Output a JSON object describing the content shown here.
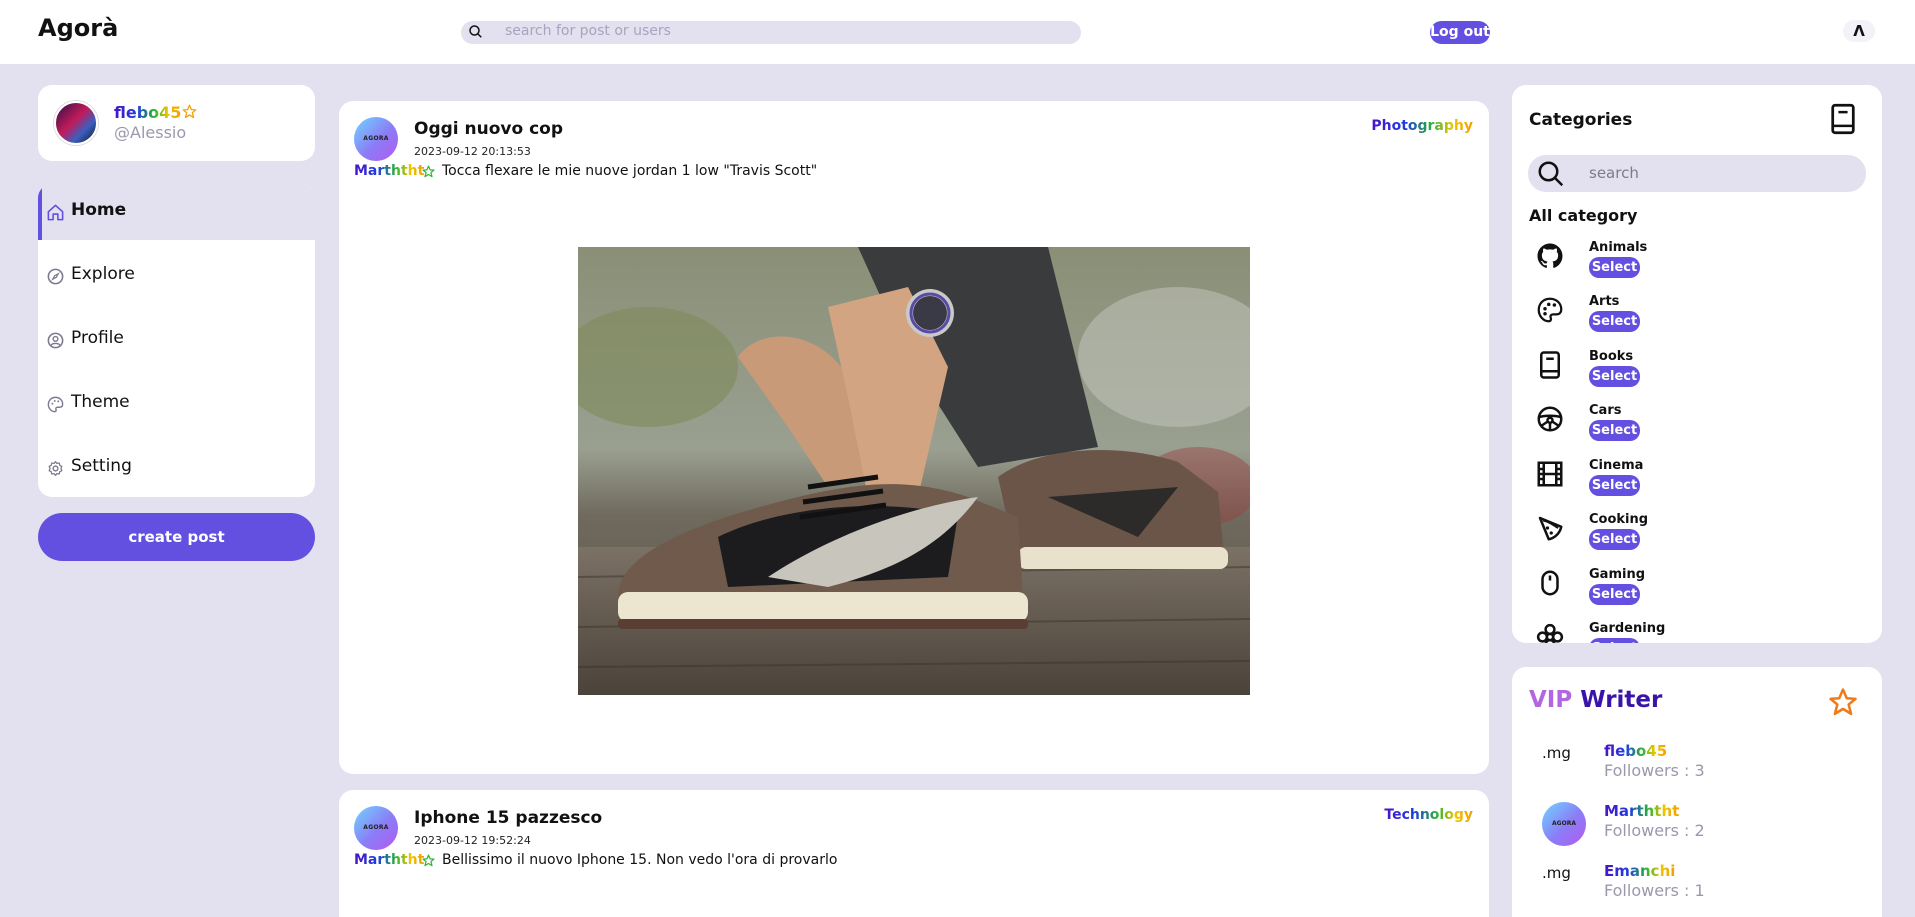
{
  "header": {
    "brand": "Agorà",
    "search_placeholder": "search for post or users",
    "logout_label": "Log out",
    "theme_toggle": "Λ"
  },
  "user": {
    "name": "flebo45",
    "handle": "@Alessio"
  },
  "nav": {
    "items": [
      {
        "label": "Home",
        "icon": "home-icon"
      },
      {
        "label": "Explore",
        "icon": "compass-icon"
      },
      {
        "label": "Profile",
        "icon": "user-circle-icon"
      },
      {
        "label": "Theme",
        "icon": "palette-icon"
      },
      {
        "label": "Setting",
        "icon": "gear-icon"
      }
    ]
  },
  "create_post_label": "create post",
  "posts": [
    {
      "title": "Oggi nuovo cop",
      "date": "2023-09-12 20:13:53",
      "category": "Photography",
      "author": "Marththt",
      "text": "Tocca flexare le mie nuove jordan 1 low \"Travis Scott\"",
      "avatar_text": "AGORA"
    },
    {
      "title": "Iphone 15 pazzesco",
      "date": "2023-09-12 19:52:24",
      "category": "Technology",
      "author": "Marththt",
      "text": "Bellissimo il nuovo Iphone 15. Non vedo l'ora di provarlo",
      "avatar_text": "AGORA"
    }
  ],
  "categories": {
    "title": "Categories",
    "search_placeholder": "search",
    "all_label": "All category",
    "select_label": "Select",
    "items": [
      {
        "name": "Animals",
        "icon": "github-icon"
      },
      {
        "name": "Arts",
        "icon": "palette-icon"
      },
      {
        "name": "Books",
        "icon": "book-icon"
      },
      {
        "name": "Cars",
        "icon": "steering-wheel-icon"
      },
      {
        "name": "Cinema",
        "icon": "film-icon"
      },
      {
        "name": "Cooking",
        "icon": "pizza-icon"
      },
      {
        "name": "Gaming",
        "icon": "mouse-icon"
      },
      {
        "name": "Gardening",
        "icon": "flower-icon"
      }
    ]
  },
  "vip": {
    "title_part1": "VIP",
    "title_part2": "Writer",
    "writers": [
      {
        "name": "flebo45",
        "followers": "Followers : 3",
        "avatar": ".mg"
      },
      {
        "name": "Marththt",
        "followers": "Followers : 2",
        "avatar": "AGORA"
      },
      {
        "name": "Emanchi",
        "followers": "Followers : 1",
        "avatar": ".mg"
      }
    ]
  },
  "colors": {
    "accent": "#6450e0",
    "page_bg": "#e3e1ef",
    "vip_star": "#f07a1a"
  }
}
